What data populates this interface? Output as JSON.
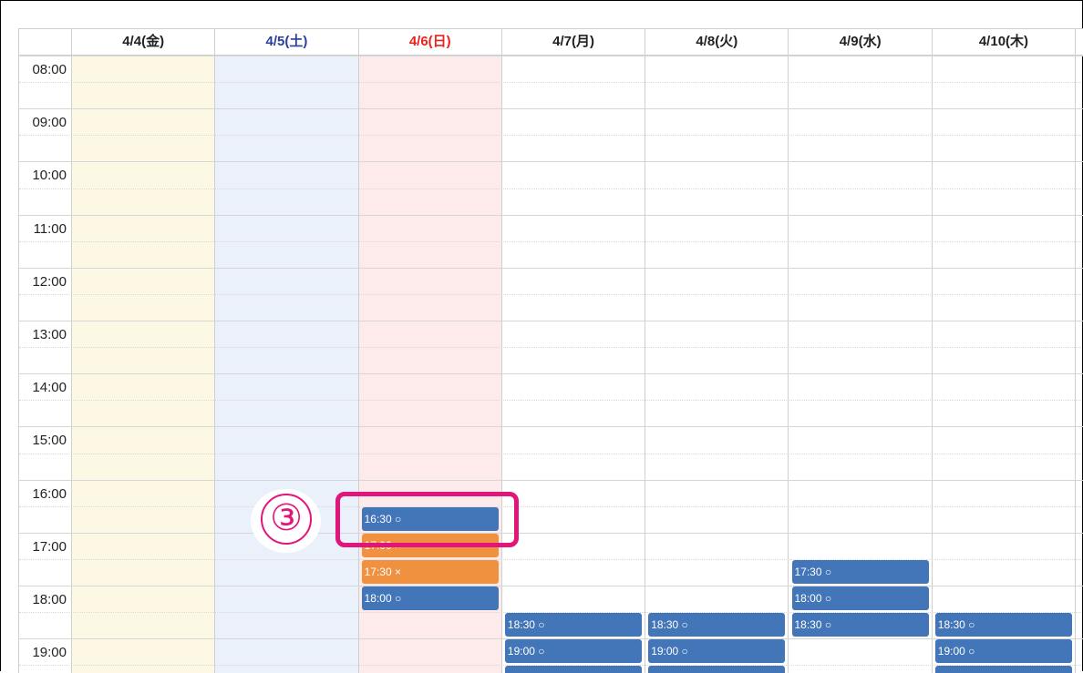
{
  "calendar": {
    "days": [
      {
        "label": "4/4(金)",
        "color": "#222222",
        "bg": "#fdf8e3"
      },
      {
        "label": "4/5(土)",
        "color": "#2a3f9e",
        "bg": "#eaf1fa"
      },
      {
        "label": "4/6(日)",
        "color": "#e8231f",
        "bg": "#fdeaea"
      },
      {
        "label": "4/7(月)",
        "color": "#222222",
        "bg": "#ffffff"
      },
      {
        "label": "4/8(火)",
        "color": "#222222",
        "bg": "#ffffff"
      },
      {
        "label": "4/9(水)",
        "color": "#222222",
        "bg": "#ffffff"
      },
      {
        "label": "4/10(木)",
        "color": "#222222",
        "bg": "#ffffff"
      }
    ],
    "times": [
      "08:00",
      "09:00",
      "10:00",
      "11:00",
      "12:00",
      "13:00",
      "14:00",
      "15:00",
      "16:00",
      "17:00",
      "18:00",
      "19:00"
    ],
    "events": [
      {
        "day": 2,
        "start": "16:30",
        "label": "16:30 ○",
        "status": "available"
      },
      {
        "day": 2,
        "start": "17:00",
        "label": "17:00 ×",
        "status": "full"
      },
      {
        "day": 2,
        "start": "17:30",
        "label": "17:30 ×",
        "status": "full"
      },
      {
        "day": 2,
        "start": "18:00",
        "label": "18:00 ○",
        "status": "available"
      },
      {
        "day": 3,
        "start": "18:30",
        "label": "18:30 ○",
        "status": "available"
      },
      {
        "day": 3,
        "start": "19:00",
        "label": "19:00 ○",
        "status": "available"
      },
      {
        "day": 3,
        "start": "19:30",
        "label": "",
        "status": "available"
      },
      {
        "day": 4,
        "start": "18:30",
        "label": "18:30 ○",
        "status": "available"
      },
      {
        "day": 4,
        "start": "19:00",
        "label": "19:00 ○",
        "status": "available"
      },
      {
        "day": 4,
        "start": "19:30",
        "label": "",
        "status": "available"
      },
      {
        "day": 5,
        "start": "17:30",
        "label": "17:30 ○",
        "status": "available"
      },
      {
        "day": 5,
        "start": "18:00",
        "label": "18:00 ○",
        "status": "available"
      },
      {
        "day": 5,
        "start": "18:30",
        "label": "18:30 ○",
        "status": "available"
      },
      {
        "day": 6,
        "start": "18:30",
        "label": "18:30 ○",
        "status": "available"
      },
      {
        "day": 6,
        "start": "19:00",
        "label": "19:00 ○",
        "status": "available"
      },
      {
        "day": 6,
        "start": "19:30",
        "label": "",
        "status": "available"
      }
    ],
    "status_colors": {
      "available": "#4376b9",
      "full": "#f0913f"
    }
  },
  "annotation": {
    "step_number": "③",
    "highlight_color": "#e2157a"
  }
}
